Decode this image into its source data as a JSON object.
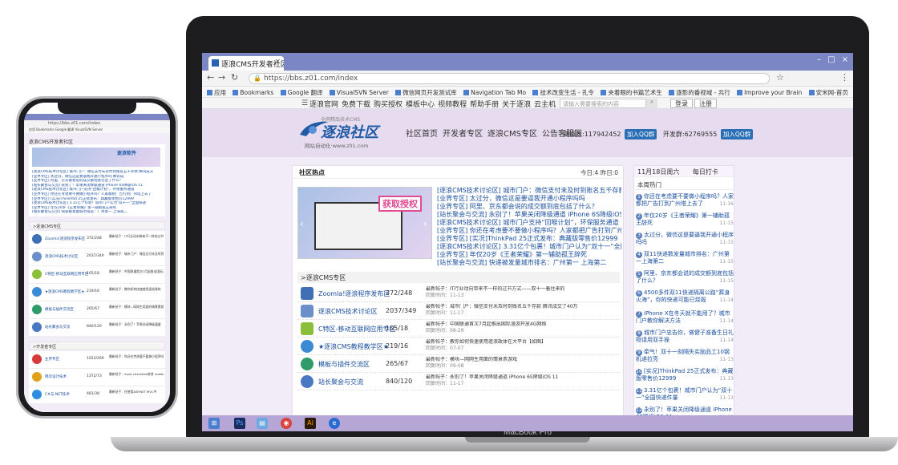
{
  "device": "MacBook Pro",
  "browser": {
    "tab_title": "逐浪CMS开发者社区",
    "url": "https://bbs.z01.com/index",
    "bookmarks": [
      "应用",
      "Bookmarks",
      "Google 翻译",
      "VisualSVN Server",
      "微信网页开发测试库",
      "Navigation Tab Mo",
      "技术改变生活 - 孔令",
      "夹着眼的书篇艺术生",
      "逐影的番视域 - 共行",
      "Improve your Brain",
      "安米网-首页"
    ]
  },
  "topnav": {
    "links": [
      "逐浪官网",
      "免费下载",
      "购买授权",
      "模板中心",
      "视频教程",
      "帮助手册",
      "关于逐浪",
      "云主机"
    ],
    "search_placeholder": "请输入需要搜索的内容",
    "login": "登录",
    "register": "注册"
  },
  "header": {
    "logo_text": "逐浪社区",
    "logo_tagline": "全网精品技术CMS",
    "logo_url": "网站自动化·www.z01.com",
    "nav": [
      "社区首页",
      "开发者专区",
      "逐浪CMS专区",
      "公告客服区"
    ],
    "qq_group_1": "高级群:117942452",
    "qq_group_2": "开发群:62769555",
    "join_qq": "加入QQ群"
  },
  "hot": {
    "title": "社区热点",
    "stats": "今日:4  昨日:0",
    "slide_badge": "获取授权",
    "items": [
      "[逐浪CMS技术讨论区] 城市门户：微信支付未及时到账名五千存款 腾讯",
      "[业界专区] 太过分，微信这是要逼我开通小程序吗吗",
      "[业界专区] 阿里、京东都会说的成交额到底包括了什么？",
      "[站长聚会与交流] 永别了！苹果关闭降级通道 iPhone 6S降级iOS 11",
      "[逐浪CMS技术讨论区] 城市门户支持“回喉计划”，环保服务通道",
      "[业界专区] 你还在考虑要不要做小程序吗？人家都把广告打到广州塔上去了",
      "[业界专区] [实况]ThinkPad 25正式发布：典藏版零售价12999",
      "[逐浪CMS技术讨论区] 3.31亿个包裹！城市门户认为“双十一”全国快递",
      "[业界专区] 年仅20岁《王者荣耀》第一辅助孤王辞死",
      "[站长聚会与交流] 快递被发量城市排名：广州第一 上海第二"
    ]
  },
  "cms_section": {
    "title": ">逐浪CMS专区",
    "forums": [
      {
        "name": "Zoomla!逐浪程序发布区",
        "count": "372/248",
        "last": "最新帖子：IT行业动向带来不一样的过节方式——双十一着住来的",
        "date": "回复时间：11-13"
      },
      {
        "name": "逐浪CMS技术讨论区",
        "count": "2037/349",
        "last": "最新帖子：城市门户：微信支付未及时到账名五千存款 腾讯成交了40万",
        "date": "回复时间：11-17"
      },
      {
        "name": "C特区-移动互联网应用专区",
        "count": "105/18",
        "last": "最新帖子：中国联通首次7月起推出国际漫游开放4G网络",
        "date": "回复时间：08-29"
      },
      {
        "name": "★逐浪CMS教程教学区★",
        "count": "219/16",
        "last": "最新帖子：教你如何快速使用逐浪政体在大平台【如图】",
        "date": "回复时间：07-07"
      },
      {
        "name": "模板与插件交流区",
        "count": "265/67",
        "last": "最新帖子：模块—网网生用面的情景票游戏",
        "date": "回复时间：09-08"
      },
      {
        "name": "站长聚会与交流",
        "count": "840/120",
        "last": "最新帖子：永别了！苹果关闭降级通道 iPhone 6S降级iOS 11",
        "date": "回复时间：11-17"
      }
    ]
  },
  "sidebar": {
    "date": "11月18日周六",
    "checkin": "每日打卡",
    "title": "本周热门",
    "items": [
      {
        "text": "你还在考虑要不要做小程序吗？人家都把广告打到广州塔上去了",
        "date": "11-16"
      },
      {
        "text": "年仅20岁《王者荣耀》第一辅助孤王辞死",
        "date": "11-15"
      },
      {
        "text": "太过分，微信这是要逼我开通小程序吗吗",
        "date": "11-15"
      },
      {
        "text": "双11快递数发量城市排名：广州第一上海第二",
        "date": "11-15"
      },
      {
        "text": "阿里、京东都会说的成交额到底包括了什么？",
        "date": "11-15"
      },
      {
        "text": "4500多件双11快递隔离公路“葬身火海”，你的快递可能已烧毁",
        "date": "11-14"
      },
      {
        "text": "iPhone X在冬天就不能用了？城市门户教你解决方法",
        "date": "11-14"
      },
      {
        "text": "城市门户忠告你，做健子准备生日礼物请用双手操",
        "date": "11-14"
      },
      {
        "text": "牵气！双十一刻隔失实励品工10钢机递拉亮",
        "date": "11-13"
      },
      {
        "text": "[实况]ThinkPad 25正式发布：典藏版零售价12999",
        "date": "11-13"
      },
      {
        "text": "3.31亿个包裹！城市门户认为“双十一”全国快递件量",
        "date": "11-13"
      },
      {
        "text": "永别了！苹果关闭降级通道 iPhone 6S降级iOS 11",
        "date": "11-13"
      }
    ]
  },
  "phone": {
    "url": "https://bbs.z01.com/index",
    "page_title": "逐浪CMS开发者社区",
    "logo": "逐浪软件",
    "hot_items": [
      "[逐浪CMS技术讨论区] 城市门户：微信支付未及时到账名五千存款 腾讯成交",
      "[业界专区] 太过分，微信这是要逼我开通小程序吗 腾讯成",
      "[业界专区] 阿里、京东都会说的成交额到底包括了什么？",
      "[站长聚会与交流] 永别了！苹果关闭降级通道 iPhone 6S降级iOS 11",
      "[逐浪CMS技术讨论区] 城市门户支持“回喉计划”，环保服务通道",
      "[业界专区] 你还在考虑要不要做小程序吗？人家都把广告打到广州塔上去了",
      "[业界专区] [实况]ThinkPad 25正式发布：典藏版零售价12999",
      "[逐浪CMS技术讨论区] 3.31亿个包裹！城市门户认为“双十一”全国快递",
      "[业界专区] 年仅20岁《王者荣耀》第一辅助孤王辞死",
      "[站长聚会与交流] 快递被发量城市排名：广州第一 上海第二"
    ],
    "cms_title": ">逐浪CMS专区",
    "cms_rows": [
      {
        "name": "Zoomla!逐浪程序发布区",
        "count": "372/248",
        "last": "最新帖子：IT行业动向带来不一样的过节方式"
      },
      {
        "name": "逐浪CMS技术讨论区",
        "count": "2037/349",
        "last": "最新帖子：城市门户：微信支付未及时到账名五千存款"
      },
      {
        "name": "C特区-移动互联网应用专区",
        "count": "105/18",
        "last": "最新帖子：中国联通首次7月起推出国际漫游"
      },
      {
        "name": "★逐浪CMS教程教学区★",
        "count": "219/16",
        "last": "最新帖子：教你如何快速使用逐浪政体"
      },
      {
        "name": "模板与插件交流区",
        "count": "265/67",
        "last": "最新帖子：模块—网网生用面的情景票游戏"
      },
      {
        "name": "站长聚会与交流",
        "count": "840/120",
        "last": "最新帖子：永别了！苹果关闭降级通道"
      }
    ],
    "dev_title": ">开发者专区",
    "dev_rows": [
      {
        "name": "业界专区",
        "count": "1022/269",
        "last": "最新帖子：你还在考虑要不要做小程序吗"
      },
      {
        "name": "网页设计技术",
        "count": "1372/73",
        "last": "最新帖子：input checkbox修改 indeterminate状态"
      },
      {
        "name": "C#与.NET技术",
        "count": "481/38",
        "last": "最新帖子：在使用ASP.NET MVC中"
      }
    ]
  },
  "colors": {
    "accent": "#7b86c4",
    "link": "#1a4fa0",
    "page_bg": "#f1ecf7"
  }
}
